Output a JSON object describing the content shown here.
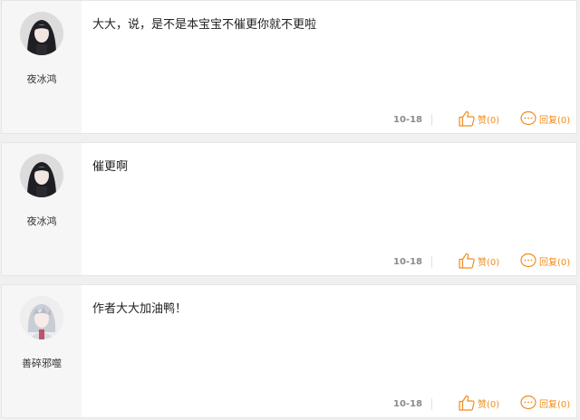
{
  "accent_color": "#f08c1e",
  "comments": [
    {
      "username": "夜冰鸿",
      "avatar_icon": "dark-haired-avatar",
      "text": "大大，说，是不是本宝宝不催更你就不更啦",
      "date": "10-18",
      "like_label": "赞(0)",
      "reply_label": "回复(0)"
    },
    {
      "username": "夜冰鸿",
      "avatar_icon": "dark-haired-avatar",
      "text": "催更啊",
      "date": "10-18",
      "like_label": "赞(0)",
      "reply_label": "回复(0)"
    },
    {
      "username": "善碎邪噬",
      "avatar_icon": "silver-haired-avatar",
      "text": "作者大大加油鸭！",
      "date": "10-18",
      "like_label": "赞(0)",
      "reply_label": "回复(0)"
    }
  ]
}
